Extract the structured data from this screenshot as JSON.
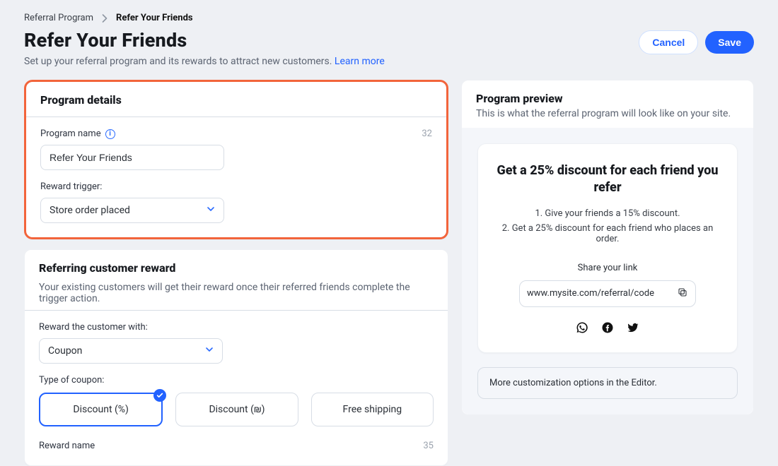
{
  "breadcrumb": {
    "root": "Referral Program",
    "current": "Refer Your Friends"
  },
  "header": {
    "title": "Refer Your Friends",
    "subtitle": "Set up your referral program and its rewards to attract new customers. ",
    "learn_more": "Learn more"
  },
  "actions": {
    "cancel": "Cancel",
    "save": "Save"
  },
  "program_details": {
    "title": "Program details",
    "name_label": "Program name",
    "name_count": "32",
    "name_value": "Refer Your Friends",
    "trigger_label": "Reward trigger:",
    "trigger_value": "Store order placed"
  },
  "referring_reward": {
    "title": "Referring customer reward",
    "subtitle": "Your existing customers will get their reward once their referred friends complete the trigger action.",
    "reward_with_label": "Reward the customer with:",
    "reward_with_value": "Coupon",
    "type_label": "Type of coupon:",
    "options": {
      "discount_percent": "Discount (%)",
      "discount_currency": "Discount (₪)",
      "free_shipping": "Free shipping"
    },
    "selected_option": "discount_percent",
    "reward_name_label": "Reward name",
    "reward_name_count": "35"
  },
  "preview": {
    "title": "Program preview",
    "subtitle": "This is what the referral program will look like on your site.",
    "card": {
      "headline": "Get a 25% discount for each friend you refer",
      "step1_prefix": "1. ",
      "step1": "Give your friends a 15% discount.",
      "step2_prefix": "2. ",
      "step2": "Get a 25% discount for each friend who places an order.",
      "share_label": "Share your link",
      "share_url": "www.mysite.com/referral/code"
    },
    "editor_note": "More customization options in the Editor."
  },
  "icons": {
    "chevron_right": "chevron-right-icon",
    "info": "info-icon",
    "chevron_down": "chevron-down-icon",
    "check": "check-icon",
    "copy": "copy-icon",
    "whatsapp": "whatsapp-icon",
    "facebook": "facebook-icon",
    "twitter": "twitter-icon"
  }
}
